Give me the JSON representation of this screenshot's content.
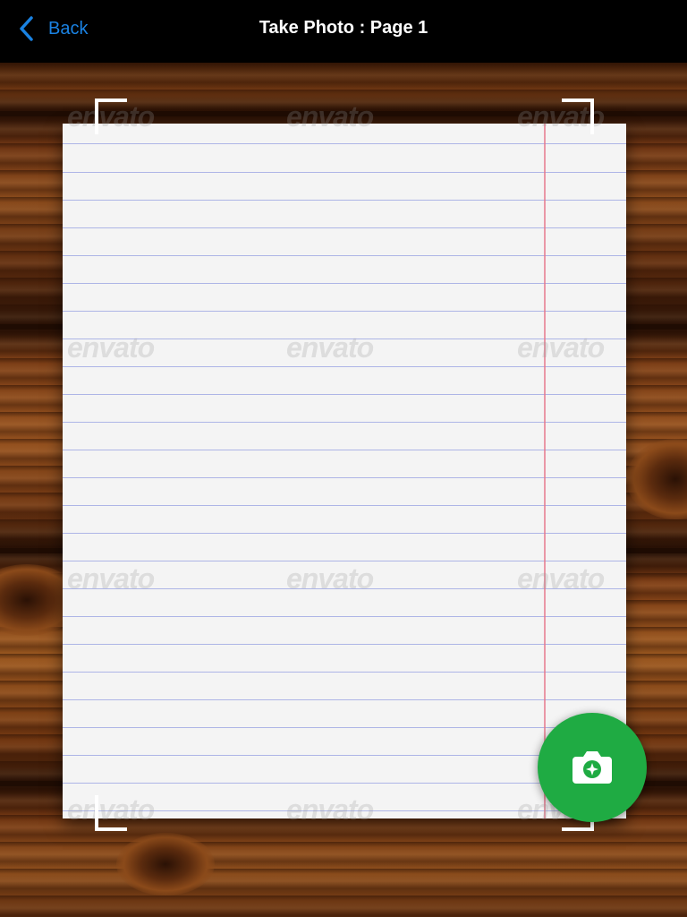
{
  "navbar": {
    "back_label": "Back",
    "title": "Take Photo : Page 1"
  },
  "watermark": {
    "text": "envato"
  },
  "icons": {
    "back": "chevron-left-icon",
    "capture": "camera-icon"
  },
  "colors": {
    "accent_blue": "#1a82e2",
    "capture_green": "#1fab43",
    "navbar_bg": "#000000"
  }
}
